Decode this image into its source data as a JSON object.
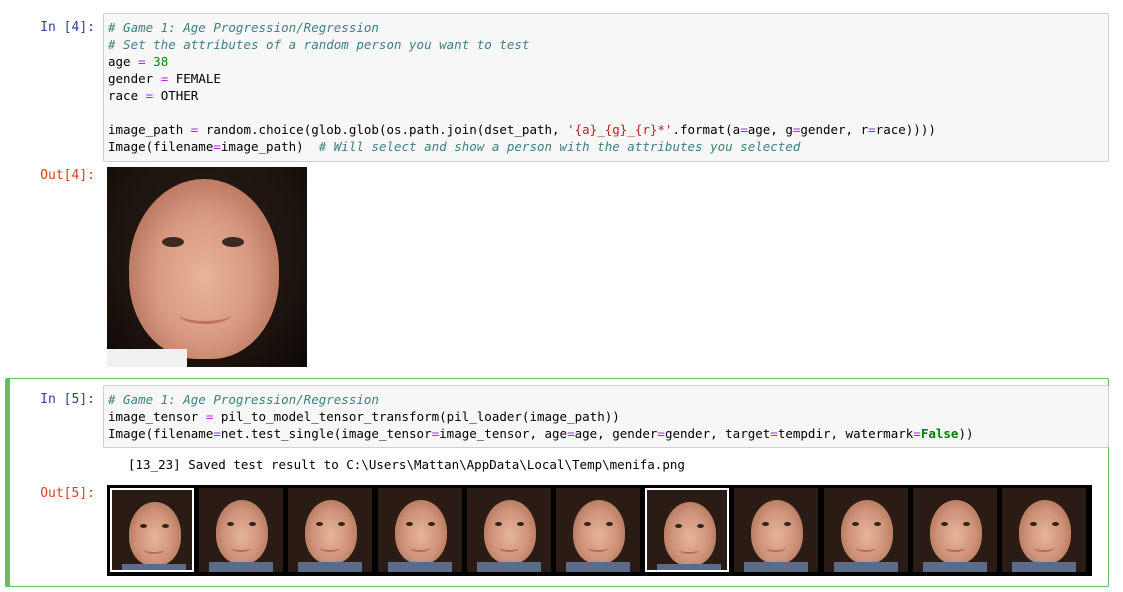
{
  "cells": {
    "cell4": {
      "in_prompt": "In [4]:",
      "out_prompt": "Out[4]:",
      "code": {
        "l1": "# Game 1: Age Progression/Regression",
        "l2": "# Set the attributes of a random person you want to test",
        "l3_name": "age",
        "l3_op": "=",
        "l3_val": "38",
        "l4_name": "gender",
        "l4_op": "=",
        "l4_val": "FEMALE",
        "l5_name": "race",
        "l5_op": "=",
        "l5_val": "OTHER",
        "l7_a": "image_path",
        "l7_op": "=",
        "l7_b": "random.choice(glob.glob(os.path.join(dset_path, ",
        "l7_str": "'{a}_{g}_{r}*'",
        "l7_c": ".format(a",
        "l7_op2": "=",
        "l7_d": "age, g",
        "l7_op3": "=",
        "l7_e": "gender, r",
        "l7_op4": "=",
        "l7_f": "race))))",
        "l8_a": "Image(filename",
        "l8_op": "=",
        "l8_b": "image_path)  ",
        "l8_cm": "# Will select and show a person with the attributes you selected"
      }
    },
    "cell5": {
      "in_prompt": "In [5]:",
      "out_prompt": "Out[5]:",
      "code": {
        "l1": "# Game 1: Age Progression/Regression",
        "l2_a": "image_tensor",
        "l2_op": "=",
        "l2_b": "pil_to_model_tensor_transform(pil_loader(image_path))",
        "l3_a": "Image(filename",
        "l3_op": "=",
        "l3_b": "net.test_single(image_tensor",
        "l3_op2": "=",
        "l3_c": "image_tensor, age",
        "l3_op3": "=",
        "l3_d": "age, gender",
        "l3_op4": "=",
        "l3_e": "gender, target",
        "l3_op5": "=",
        "l3_f": "tempdir, watermark",
        "l3_op6": "=",
        "l3_kw": "False",
        "l3_g": "))"
      },
      "stream": "[13_23] Saved test result to C:\\Users\\Mattan\\AppData\\Local\\Temp\\menifa.png",
      "thumbnails": [
        {
          "watermark": true
        },
        {
          "watermark": false
        },
        {
          "watermark": false
        },
        {
          "watermark": false
        },
        {
          "watermark": false
        },
        {
          "watermark": false
        },
        {
          "watermark": true
        },
        {
          "watermark": false
        },
        {
          "watermark": false
        },
        {
          "watermark": false
        },
        {
          "watermark": false
        }
      ]
    }
  },
  "colors": {
    "selected_border": "#66bb6a",
    "in_prompt": "#303f9f",
    "out_prompt": "#d84315"
  }
}
